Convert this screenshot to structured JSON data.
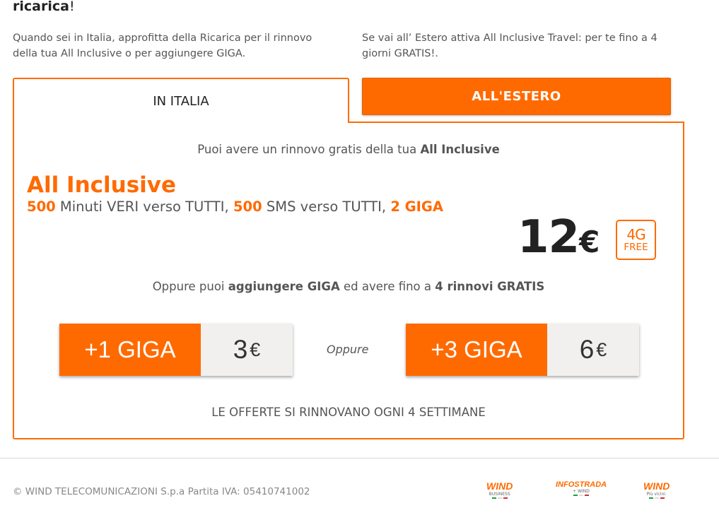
{
  "heading": {
    "bold": "ricarica",
    "rest": "!"
  },
  "intro": {
    "left": "Quando sei in Italia, approfitta della Ricarica per il rinnovo della tua All Inclusive o per aggiungere GIGA.",
    "right": "Se vai all’ Estero attiva All Inclusive Travel: per te fino a 4 giorni GRATIS!."
  },
  "tabs": [
    {
      "label": "IN ITALIA",
      "active": true
    },
    {
      "label": "ALL'ESTERO",
      "active": false
    }
  ],
  "panel": {
    "line1": {
      "text": "Puoi avere un rinnovo gratis della tua ",
      "bold": "All Inclusive"
    },
    "offer": {
      "title": "All Inclusive",
      "minutes_num": "500",
      "minutes_text": " Minuti VERI verso TUTTI, ",
      "sms_num": "500",
      "sms_text": " SMS verso TUTTI, ",
      "giga": "2 GIGA"
    },
    "price": {
      "amount": "12",
      "currency": "€"
    },
    "badge": {
      "top": "4G",
      "bottom": "FREE"
    },
    "line2": {
      "a": "Oppure puoi ",
      "b": "aggiungere GIGA",
      "c": " ed avere fino a ",
      "d": "4 rinnovi GRATIS"
    },
    "giga_options": [
      {
        "label": "+1 GIGA",
        "price": "3",
        "currency": "€"
      },
      {
        "label": "+3 GIGA",
        "price": "6",
        "currency": "€"
      }
    ],
    "oppure": "Oppure",
    "footnote": "LE OFFERTE SI RINNOVANO OGNI 4 SETTIMANE"
  },
  "footer": {
    "copyright": "© WIND TELECOMUNICAZIONI S.p.a Partita IVA: 05410741002",
    "logos": [
      {
        "name": "WIND",
        "sub": "BUSINESS"
      },
      {
        "name": "INFOSTRADA",
        "sub": "+ WIND"
      },
      {
        "name": "WIND",
        "sub": "Più vicini."
      }
    ]
  },
  "colors": {
    "accent": "#ff6a00",
    "price_box": "#f1f0ee",
    "text": "#555555"
  }
}
